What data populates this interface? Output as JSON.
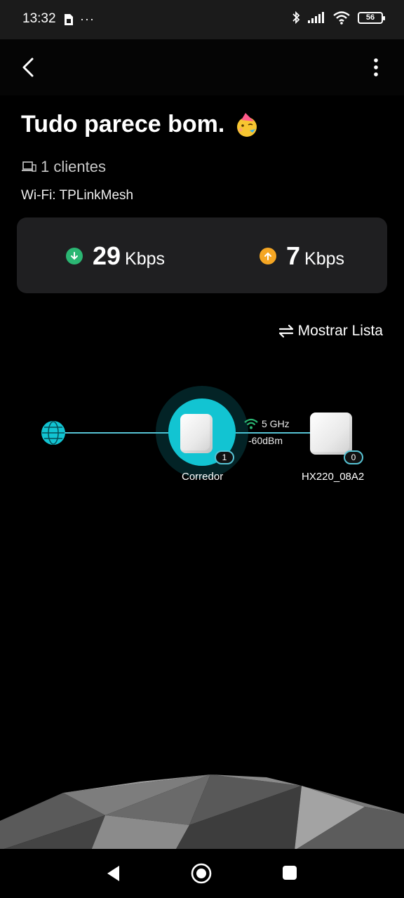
{
  "status_bar": {
    "time": "13:32",
    "more_indicator": "···",
    "battery_level": "56",
    "icons": [
      "sim-card-icon",
      "bluetooth-icon",
      "signal-icon",
      "wifi-icon",
      "battery-icon"
    ]
  },
  "app_bar": {
    "back_icon": "chevron-left-icon",
    "menu_icon": "vertical-dots-icon"
  },
  "summary": {
    "headline": "Tudo parece bom.",
    "emoji": "party-face-emoji",
    "clients_text": "1 clientes",
    "wifi_text": "Wi-Fi: TPLinkMesh"
  },
  "speeds": {
    "download": {
      "value": "29",
      "unit": "Kbps",
      "color": "#2bb673"
    },
    "upload": {
      "value": "7",
      "unit": "Kbps",
      "color": "#f5a623"
    }
  },
  "list_toggle": {
    "label": "Mostrar Lista",
    "icon": "swap-arrows-icon"
  },
  "topology": {
    "accent_color": "#12c4d2",
    "main_node": {
      "name": "Corredor",
      "clients": "1"
    },
    "satellite_node": {
      "name": "HX220_08A2",
      "clients": "0"
    },
    "link": {
      "band": "5 GHz",
      "signal": "-60dBm"
    }
  }
}
